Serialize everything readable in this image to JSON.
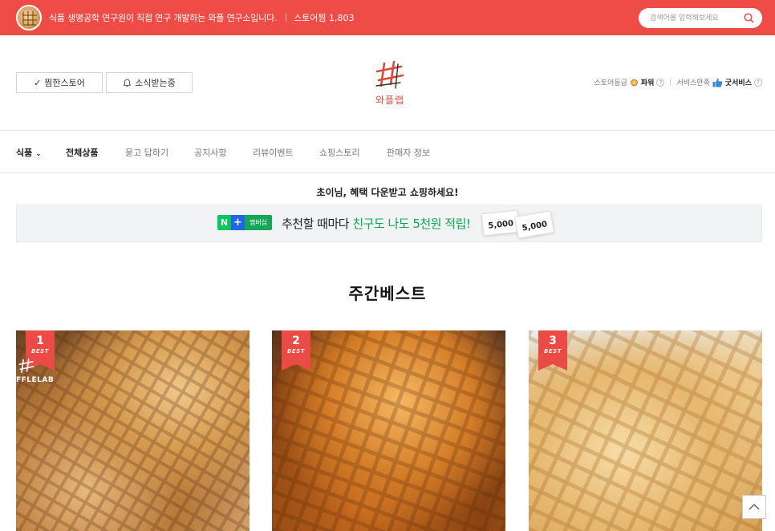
{
  "topbar": {
    "description": "식품 생명공학 연구원이 직접 연구 개발하는 와플 연구소입니다.",
    "favorites": "스토어찜 1,803",
    "search_placeholder": "검색어를 입력해보세요"
  },
  "header": {
    "fav_button": "찜한스토어",
    "fav_check": "✓",
    "news_button": "소식받는중",
    "brand_name": "와플랩",
    "grade_label": "스토어등급",
    "grade_value": "파워",
    "service_label": "서비스만족",
    "service_value": "굿서비스"
  },
  "nav": {
    "items": [
      {
        "label": "식품",
        "dropdown": "⌄"
      },
      {
        "label": "전체상품"
      },
      {
        "label": "묻고 답하기"
      },
      {
        "label": "공지사항"
      },
      {
        "label": "리뷰이벤트"
      },
      {
        "label": "쇼핑스토리"
      },
      {
        "label": "판매자 정보"
      }
    ]
  },
  "promo": {
    "greeting": "초이님, 혜택 다운받고 쇼핑하세요!",
    "badge_n": "N",
    "badge_plus": "+",
    "badge_text": "멤버십",
    "text_before": "추천할 때마다 ",
    "text_highlight": "친구도 나도 5천원 적립!",
    "coupon1": "5,000",
    "coupon2": "5,000"
  },
  "best": {
    "title": "주간베스트",
    "products": [
      {
        "rank": "1",
        "tag": "BEST",
        "watermark": "FFLELAB"
      },
      {
        "rank": "2",
        "tag": "BEST"
      },
      {
        "rank": "3",
        "tag": "BEST"
      }
    ]
  },
  "colors": {
    "brand_red": "#ef4b47",
    "ribbon": "#ea4b44",
    "highlight_green": "#0aa84d",
    "naver_green": "#03c75a"
  }
}
